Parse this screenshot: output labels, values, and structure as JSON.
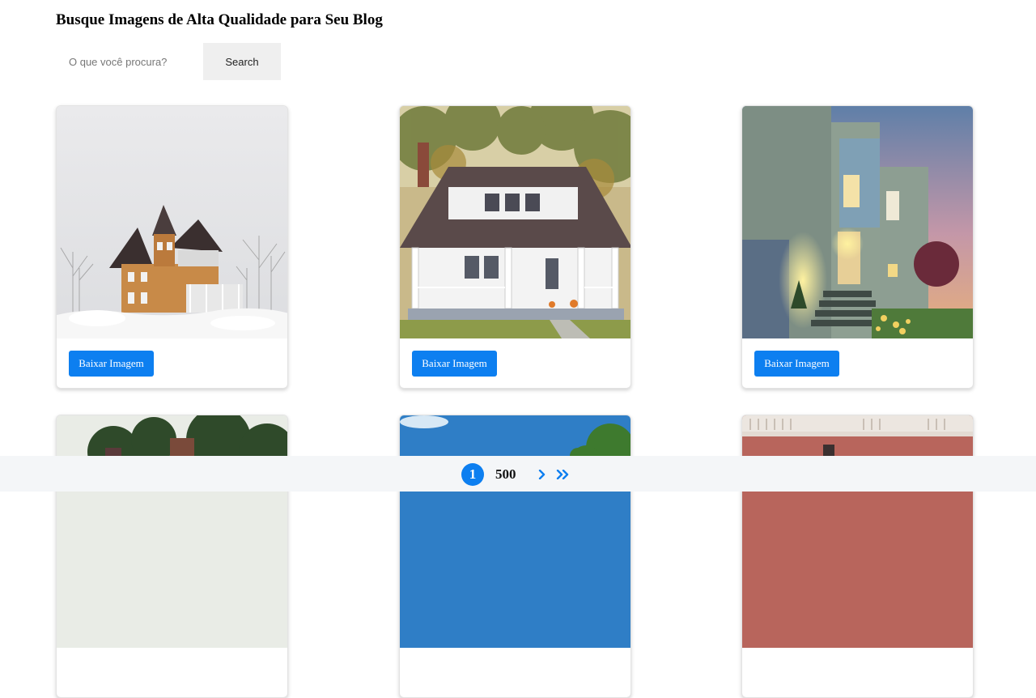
{
  "header": {
    "title": "Busque Imagens de Alta Qualidade para Seu Blog"
  },
  "search": {
    "placeholder": "O que você procura?",
    "value": "",
    "button_label": "Search"
  },
  "cards": [
    {
      "image": "snowy-victorian-house-image",
      "button_label": "Baixar Imagem"
    },
    {
      "image": "white-porch-house-image",
      "button_label": "Baixar Imagem"
    },
    {
      "image": "modern-house-dusk-image",
      "button_label": "Baixar Imagem"
    },
    {
      "image": "brick-house-trees-image"
    },
    {
      "image": "blue-sky-trees-image"
    },
    {
      "image": "brick-building-balustrade-image"
    }
  ],
  "pagination": {
    "current_page": "1",
    "last_page": "500",
    "icons": [
      "chevron-right-icon",
      "double-chevron-right-icon"
    ]
  },
  "colors": {
    "accent": "#0d7ff0",
    "footer_bg": "#f4f6f8",
    "search_button_bg": "#efefef"
  }
}
